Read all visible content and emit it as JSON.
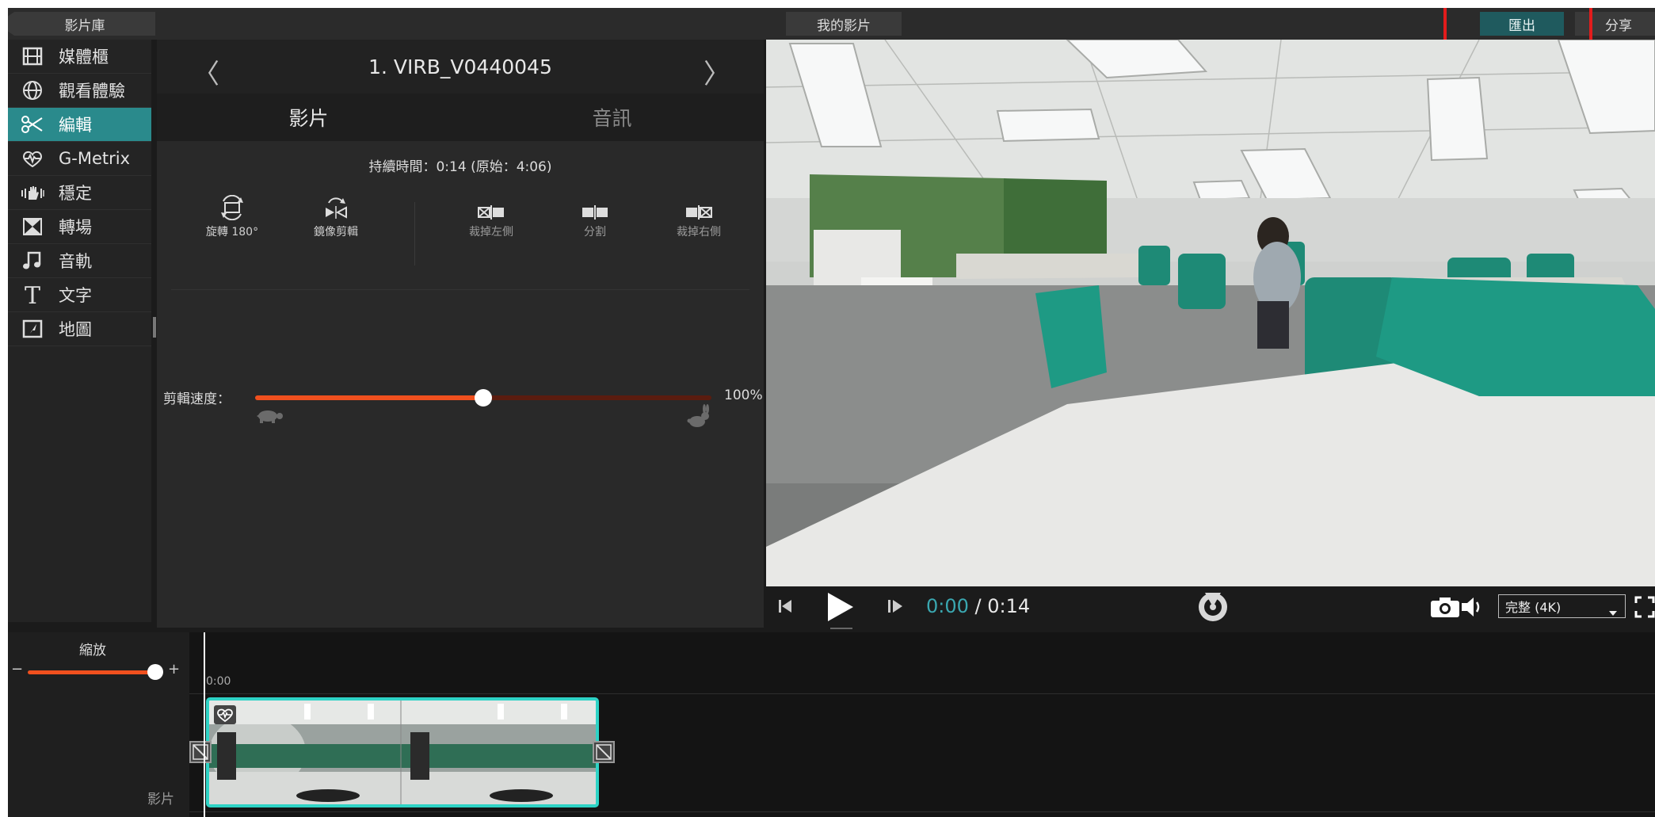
{
  "topbar": {
    "library_label": "影片庫",
    "my_videos_label": "我的影片",
    "export_label": "匯出",
    "share_label": "分享"
  },
  "sidebar": {
    "items": [
      {
        "label": "媒體櫃",
        "icon": "film-icon"
      },
      {
        "label": "觀看體驗",
        "icon": "globe-icon"
      },
      {
        "label": "編輯",
        "icon": "scissors-icon",
        "active": true
      },
      {
        "label": "G-Metrix",
        "icon": "heartbeat-icon"
      },
      {
        "label": "穩定",
        "icon": "stabilize-hand-icon"
      },
      {
        "label": "轉場",
        "icon": "transition-icon"
      },
      {
        "label": "音軌",
        "icon": "music-note-icon"
      },
      {
        "label": "文字",
        "icon": "text-icon"
      },
      {
        "label": "地圖",
        "icon": "map-icon"
      }
    ]
  },
  "editor": {
    "clip_title": "1. VIRB_V0440045",
    "tab_video": "影片",
    "tab_audio": "音訊",
    "duration_text": "持續時間：0:14 (原始：4:06)",
    "tools": {
      "rotate": "旋轉 180°",
      "mirror": "鏡像剪輯",
      "trim_left": "裁掉左側",
      "split": "分割",
      "trim_right": "裁掉右側"
    },
    "speed_label": "剪輯速度：",
    "speed_value": "100%",
    "speed_fraction": 0.5
  },
  "player": {
    "time_current": "0:00",
    "time_total": " / 0:14",
    "quality": "完整 (4K)"
  },
  "timeline": {
    "zoom_label": "縮放",
    "zoom_minus": "−",
    "zoom_plus": "+",
    "timestamp": "0:00",
    "track_label": "影片"
  },
  "colors": {
    "accent_teal": "#2a8a8c",
    "export_bg": "#1f5a5e",
    "slider_orange": "#f0501e",
    "highlight_red": "#e31c1c",
    "clip_border": "#2ed3c6"
  }
}
